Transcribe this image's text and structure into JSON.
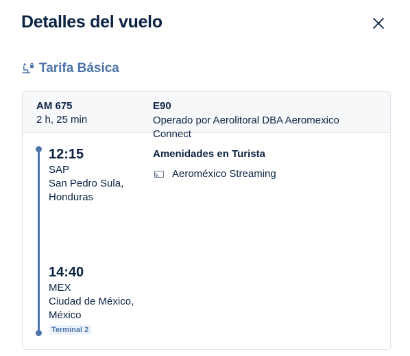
{
  "modal": {
    "title": "Detalles del vuelo",
    "close_icon": "close-icon"
  },
  "fare": {
    "icon": "seat-icon",
    "label": "Tarifa Básica",
    "color": "#4b73a8"
  },
  "flight": {
    "number": "AM 675",
    "duration": "2 h, 25 min",
    "aircraft": "E90",
    "operator": "Operado por Aerolitoral DBA Aeromexico Connect"
  },
  "departure": {
    "time": "12:15",
    "code": "SAP",
    "city": "San Pedro Sula, Honduras"
  },
  "arrival": {
    "time": "14:40",
    "code": "MEX",
    "city": "Ciudad de México, México",
    "terminal": "Terminal 2"
  },
  "amenities": {
    "title": "Amenidades en Turista",
    "items": [
      {
        "icon": "streaming-icon",
        "label": "Aeroméxico Streaming"
      }
    ]
  },
  "colors": {
    "primary_text": "#0b2343",
    "accent": "#4b73a8",
    "border": "#e1e5ea",
    "header_bg": "#f7f8fa"
  }
}
